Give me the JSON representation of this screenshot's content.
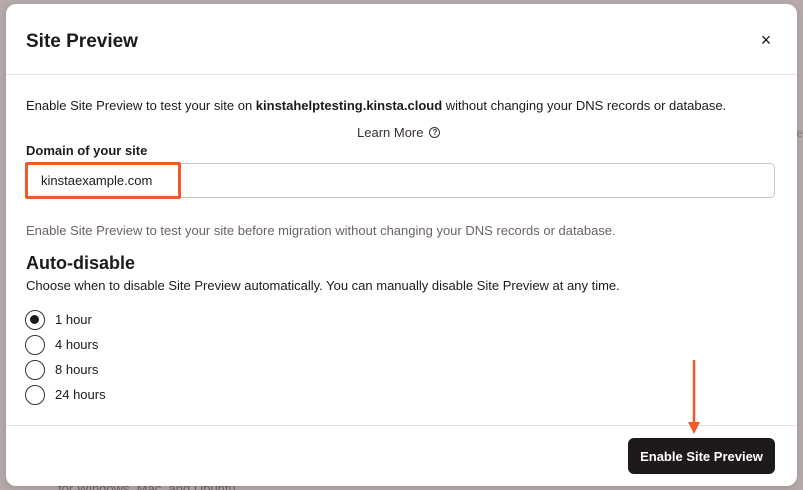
{
  "backdrop": {
    "bottom_text": "for Windows, Mac, and Ubuntu",
    "edge_text": "e"
  },
  "modal": {
    "title": "Site Preview",
    "close_label": "×",
    "intro_prefix": "Enable Site Preview to test your site on ",
    "intro_domain": "kinstahelptesting.kinsta.cloud",
    "intro_suffix": " without changing your DNS records or database.",
    "learn_more": "Learn More",
    "help_icon_glyph": "?",
    "domain_field": {
      "label": "Domain of your site",
      "value": "kinstaexample.com"
    },
    "helper_text": "Enable Site Preview to test your site before migration without changing your DNS records or database.",
    "auto_disable": {
      "title": "Auto-disable",
      "description": "Choose when to disable Site Preview automatically. You can manually disable Site Preview at any time.",
      "options": [
        {
          "label": "1 hour",
          "checked": true
        },
        {
          "label": "4 hours",
          "checked": false
        },
        {
          "label": "8 hours",
          "checked": false
        },
        {
          "label": "24 hours",
          "checked": false
        }
      ]
    },
    "primary_button": "Enable Site Preview"
  },
  "colors": {
    "highlight": "#f05a2a",
    "primary": "#1e1a1a"
  }
}
